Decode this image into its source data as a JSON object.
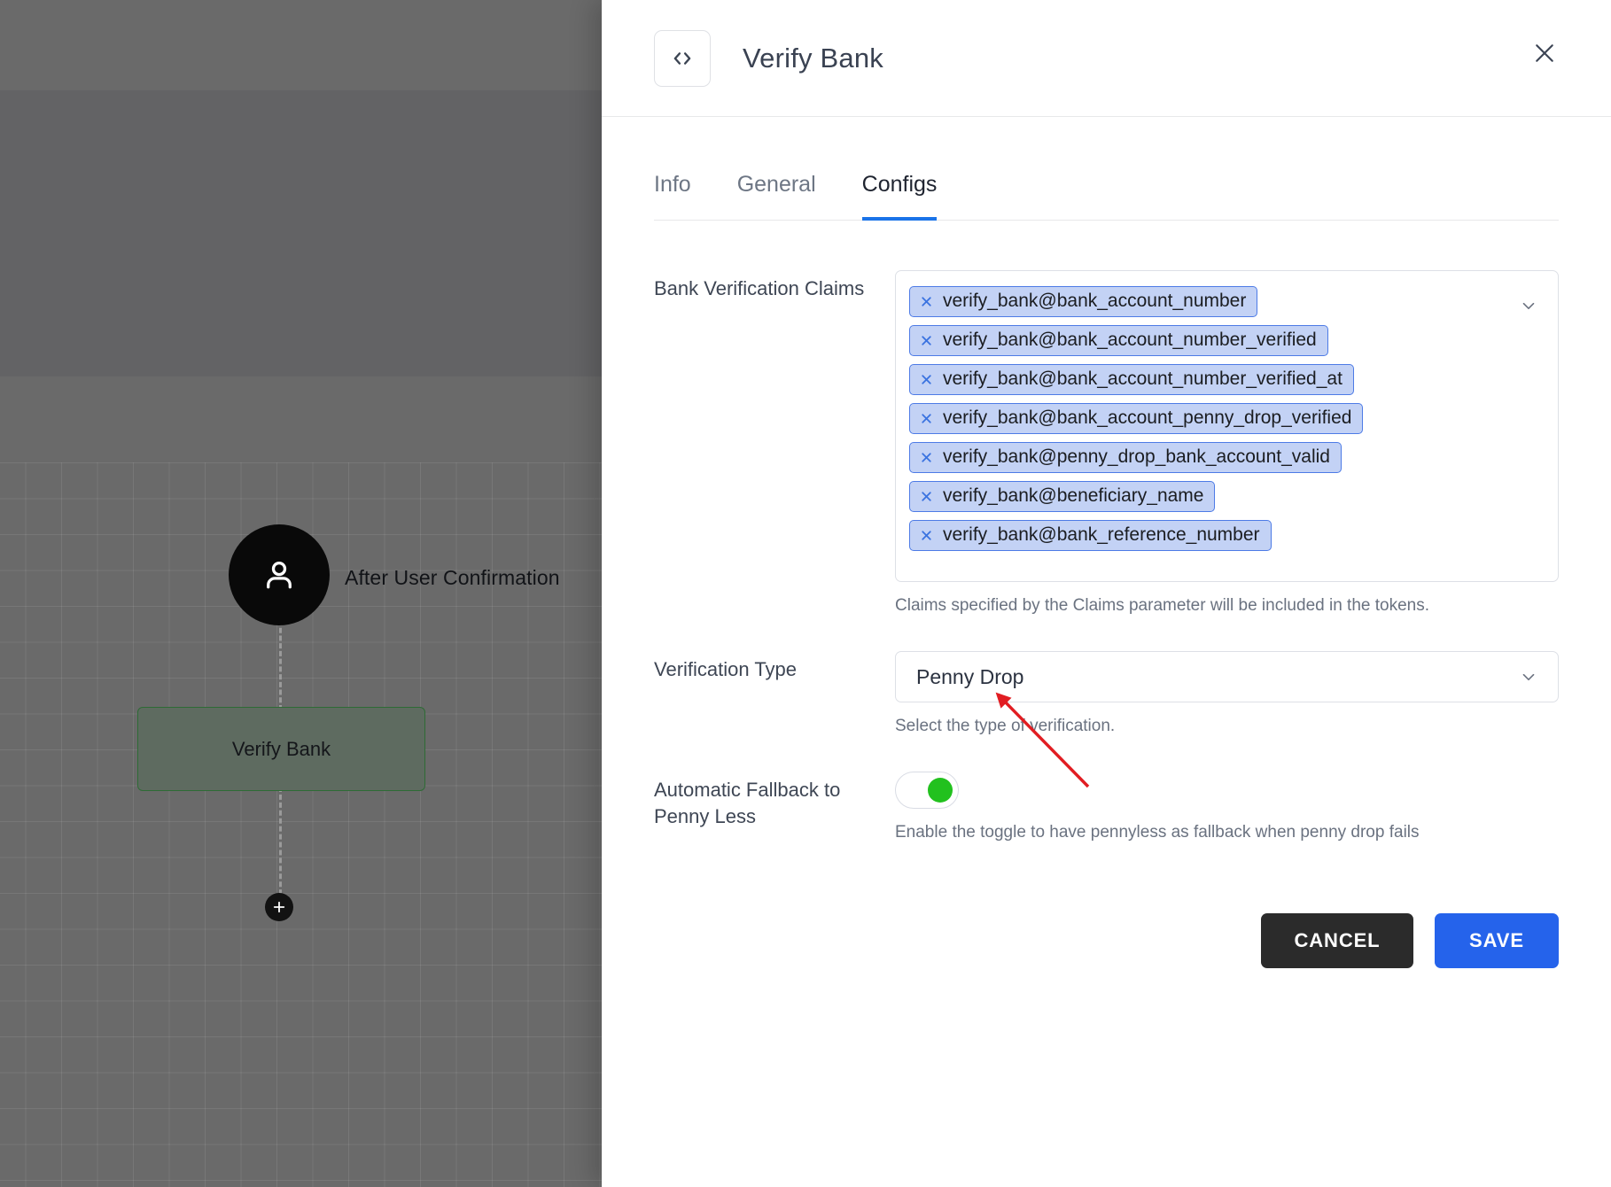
{
  "canvas": {
    "start_node": {
      "icon": "person-icon",
      "label": "After User Confirmation"
    },
    "flow_node": {
      "label": "Verify Bank"
    },
    "add_node_button": {
      "icon": "plus-icon"
    }
  },
  "panel": {
    "header": {
      "icon": "code-brackets-icon",
      "title": "Verify Bank",
      "close_icon": "close-icon"
    },
    "tabs": [
      {
        "label": "Info",
        "active": false
      },
      {
        "label": "General",
        "active": false
      },
      {
        "label": "Configs",
        "active": true
      }
    ],
    "fields": {
      "bank_verification_claims": {
        "label": "Bank Verification Claims",
        "helper": "Claims specified by the Claims parameter will be included in the tokens.",
        "caret_icon": "chevron-down-icon",
        "chips": [
          "verify_bank@bank_account_number",
          "verify_bank@bank_account_number_verified",
          "verify_bank@bank_account_number_verified_at",
          "verify_bank@bank_account_penny_drop_verified",
          "verify_bank@penny_drop_bank_account_valid",
          "verify_bank@beneficiary_name",
          "verify_bank@bank_reference_number"
        ]
      },
      "verification_type": {
        "label": "Verification Type",
        "value": "Penny Drop",
        "helper": "Select the type of verification.",
        "caret_icon": "chevron-down-icon"
      },
      "automatic_fallback": {
        "label": "Automatic Fallback to Penny Less",
        "helper": "Enable the toggle to have pennyless as fallback when penny drop fails",
        "enabled": "on"
      }
    },
    "actions": {
      "cancel_label": "CANCEL",
      "save_label": "SAVE"
    }
  },
  "colors": {
    "accent_blue": "#2563eb",
    "tab_underline": "#1a73e8",
    "chip_bg": "#c3d2f5",
    "chip_border": "#4d7be6",
    "toggle_on": "#22c11e",
    "cancel_bg": "#2b2b2b",
    "node_border": "#2e6b35",
    "annotation": "#e11d22"
  }
}
